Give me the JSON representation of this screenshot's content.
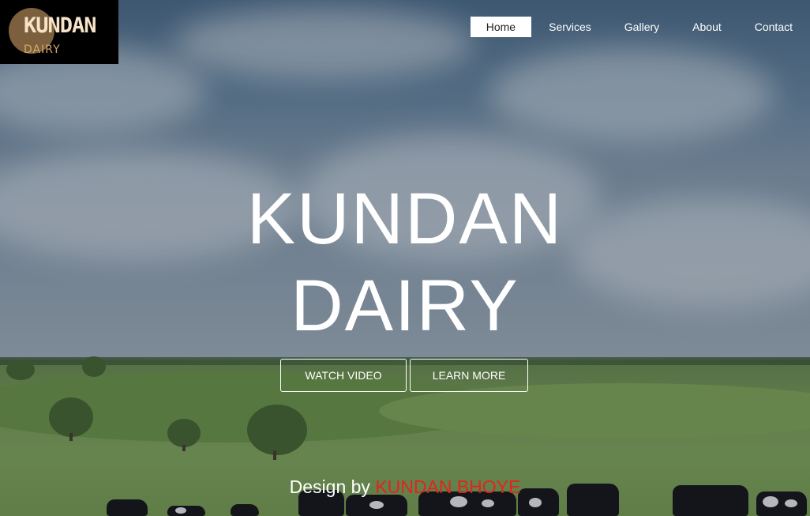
{
  "brand": {
    "name": "KUNDAN",
    "sub": "DAIRY"
  },
  "nav": {
    "items": [
      {
        "label": "Home",
        "active": true
      },
      {
        "label": "Services",
        "active": false
      },
      {
        "label": "Gallery",
        "active": false
      },
      {
        "label": "About",
        "active": false
      },
      {
        "label": "Contact",
        "active": false
      }
    ]
  },
  "hero": {
    "line1": "KUNDAN",
    "line2": "DAIRY",
    "watch_label": "WATCH VIDEO",
    "learn_label": "LEARN MORE"
  },
  "footer": {
    "prefix": "Design by",
    "author": "KUNDAN BHOYE"
  },
  "colors": {
    "accent": "#e3231b",
    "nav_active_bg": "#ffffff",
    "logo_bg": "#000000"
  }
}
